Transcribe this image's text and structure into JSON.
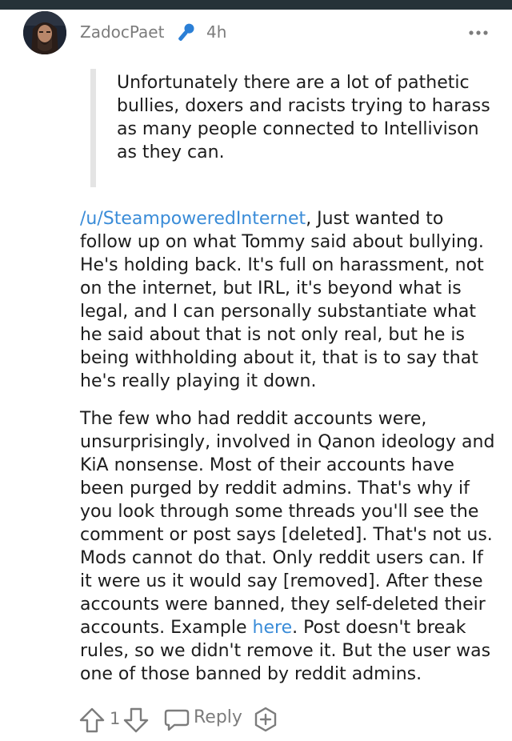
{
  "comment": {
    "username": "ZadocPaet",
    "timestamp": "4h",
    "quote": "Unfortunately there are a lot of pathetic bullies, doxers and racists trying to harass as many people connected to Intellivison as they can.",
    "paragraph1": {
      "mention": "/u/SteampoweredInternet",
      "text": ", Just wanted to follow up on what Tommy said about bullying. He's holding back. It's full on harassment, not on the internet, but IRL, it's beyond what is legal, and I can personally substantiate what he said about that is not only real, but he is being withholding about it, that is to say that he's really playing it down."
    },
    "paragraph2": {
      "before_link": "The few who had reddit accounts were, unsurprisingly, involved in Qanon ideology and KiA nonsense. Most of their accounts have been purged by reddit admins. That's why if you look through some threads you'll see the comment or post says [deleted]. That's not us. Mods cannot do that. Only reddit users can. If it were us it would say [removed]. After these accounts were banned, they self-deleted their accounts. Example ",
      "link": "here",
      "after_link": ". Post doesn't break rules, so we didn't remove it. But the user was one of those banned by reddit admins."
    }
  },
  "actions": {
    "score": "1",
    "reply_label": "Reply"
  },
  "icons": {
    "mod_badge": "microphone-icon",
    "more": "more-dots-icon",
    "upvote": "arrow-up-icon",
    "downvote": "arrow-down-icon",
    "reply": "speech-bubble-icon",
    "award": "add-award-icon"
  },
  "colors": {
    "link": "#3a8cd8",
    "mod_badge": "#2b7fd6",
    "meta_text": "#7c7c7c",
    "quote_bar": "#e4e4e4",
    "top_bar": "#263238"
  }
}
